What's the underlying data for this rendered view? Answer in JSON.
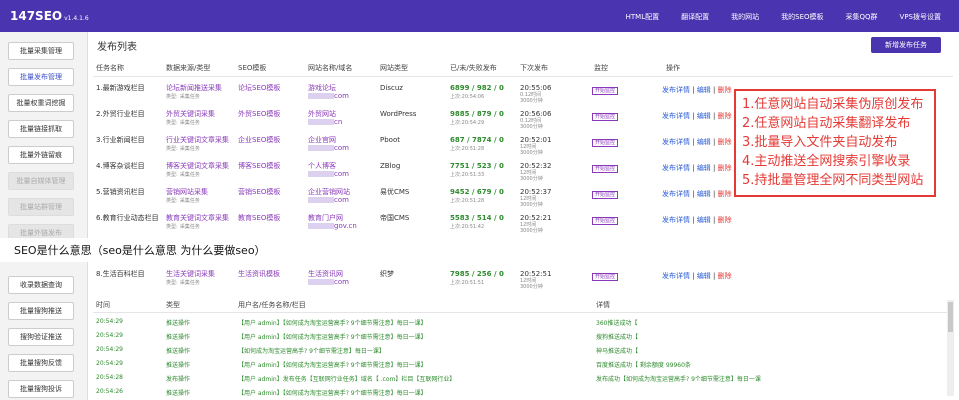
{
  "app": {
    "logo": "147SEO",
    "version": "v1.4.1.6"
  },
  "topnav": [
    "HTML配置",
    "翻译配置",
    "我的网站",
    "我的SEO模板",
    "采集QQ群",
    "VPS拨号设置"
  ],
  "sidebar": [
    {
      "label": "批量采集管理",
      "state": "normal"
    },
    {
      "label": "批量发布管理",
      "state": "active"
    },
    {
      "label": "批量权重词挖掘",
      "state": "normal"
    },
    {
      "label": "批量链接抓取",
      "state": "normal"
    },
    {
      "label": "批量外链留痕",
      "state": "normal"
    },
    {
      "label": "批量自媒体管理",
      "state": "disabled"
    },
    {
      "label": "批量站群管理",
      "state": "disabled"
    },
    {
      "label": "批量外链发布",
      "state": "disabled"
    },
    {
      "label": "收录数据查询",
      "state": "normal"
    },
    {
      "label": "批量搜狗推送",
      "state": "normal"
    },
    {
      "label": "搜狗验证推送",
      "state": "normal"
    },
    {
      "label": "批量搜狗反馈",
      "state": "normal"
    },
    {
      "label": "批量搜狗投诉",
      "state": "normal"
    }
  ],
  "page": {
    "title": "发布列表",
    "new_task": "新增发布任务"
  },
  "columns": [
    "任务名称",
    "数据来源/类型",
    "SEO模板",
    "网站名称/域名",
    "网站类型",
    "已/未/失败发布",
    "下次发布",
    "监控",
    "操作"
  ],
  "tasks": [
    {
      "name": "1.最新游戏栏目",
      "source": "论坛新闻推送采集",
      "type_label": "类型:",
      "type": "采集任务",
      "seo": "论坛SEO模板",
      "site": "游戏论坛",
      "domain": "com",
      "cms": "Discuz",
      "counts": "6899 / 982 / 0",
      "counts_l2": "上次:20:54:06",
      "next": "20:55:06",
      "next_l2": "0.12时间\n3000分钟",
      "monitor": "开始监控",
      "actions": [
        "发布详情",
        "编辑",
        "删除"
      ]
    },
    {
      "name": "2.外贸行业栏目",
      "source": "外贸关键词采集",
      "type_label": "类型:",
      "type": "采集任务",
      "seo": "外贸SEO模板",
      "site": "外贸网站",
      "domain": "cn",
      "cms": "WordPress",
      "counts": "9885 / 879 / 0",
      "counts_l2": "上次:20:54:29",
      "next": "20:56:06",
      "next_l2": "0.12时间\n3000分钟",
      "monitor": "开始监控",
      "actions": [
        "发布详情",
        "编辑",
        "删除"
      ]
    },
    {
      "name": "3.行业新闻栏目",
      "source": "行业关键词文章采集",
      "type_label": "类型:",
      "type": "采集任务",
      "seo": "企业SEO模板",
      "site": "企业官网",
      "domain": "com",
      "cms": "Pboot",
      "counts": "687 / 7874 / 0",
      "counts_l2": "上次:20:51:28",
      "next": "20:52:01",
      "next_l2": "12时间\n3000分钟",
      "monitor": "开始监控",
      "actions": [
        "发布详情",
        "编辑",
        "删除"
      ]
    },
    {
      "name": "4.博客杂谈栏目",
      "source": "博客关键词文章采集",
      "type_label": "类型:",
      "type": "采集任务",
      "seo": "博客SEO模板",
      "site": "个人博客",
      "domain": "com",
      "cms": "ZBlog",
      "counts": "7751 / 523 / 0",
      "counts_l2": "上次:20:51:33",
      "next": "20:52:32",
      "next_l2": "12时间\n3000分钟",
      "monitor": "开始监控",
      "actions": [
        "发布详情",
        "编辑",
        "删除"
      ]
    },
    {
      "name": "5.营销资讯栏目",
      "source": "营销网站采集",
      "type_label": "类型:",
      "type": "采集任务",
      "seo": "营销SEO模板",
      "site": "企业营销网站",
      "domain": "com",
      "cms": "易优CMS",
      "counts": "9452 / 679 / 0",
      "counts_l2": "上次:20:51:28",
      "next": "20:52:37",
      "next_l2": "12时间\n3000分钟",
      "monitor": "开始监控",
      "actions": [
        "发布详情",
        "编辑",
        "删除"
      ]
    },
    {
      "name": "6.教育行业动态栏目",
      "source": "教育关键词文章采集",
      "type_label": "类型:",
      "type": "采集任务",
      "seo": "教育SEO模板",
      "site": "教育门户网",
      "domain": "gov.cn",
      "cms": "帝国CMS",
      "counts": "5583 / 514 / 0",
      "counts_l2": "上次:20:51:42",
      "next": "20:52:21",
      "next_l2": "12时间\n3000分钟",
      "monitor": "开始监控",
      "actions": [
        "发布详情",
        "编辑",
        "删除"
      ]
    },
    {
      "name": "8.生活百科栏目",
      "source": "生活关键词采集",
      "type_label": "类型:",
      "type": "采集任务",
      "seo": "生活资讯模板",
      "site": "生活资讯网",
      "domain": "com",
      "cms": "织梦",
      "counts": "7985 / 256 / 0",
      "counts_l2": "上次:20:51:51",
      "next": "20:52:51",
      "next_l2": "12时间\n3000分钟",
      "monitor": "开始监控",
      "actions": [
        "发布详情",
        "编辑",
        "删除"
      ]
    }
  ],
  "callout": [
    "1.任意网站自动采集伪原创发布",
    "2.任意网站自动采集翻译发布",
    "3.批量导入文件夹自动发布",
    "4.主动推送全网搜索引擎收录",
    "5.持批量管理全网不同类型网站"
  ],
  "overlay_text": "SEO是什么意思（seo是什么意思 为什么要做seo）",
  "log": {
    "headers": [
      "时间",
      "类型",
      "用户名/任务名称/栏目",
      "详情"
    ],
    "rows": [
      {
        "time": "20:54:29",
        "type": "推送操作",
        "task": "【用户 admin】【如何成为淘宝运营高手? 9个细节需注意】每日一课】",
        "detail": "360推送成功【"
      },
      {
        "time": "20:54:29",
        "type": "推送操作",
        "task": "【用户 admin】【如何成为淘宝运营高手? 9个细节需注意】每日一课】",
        "detail": "搜狗推送成功【"
      },
      {
        "time": "20:54:29",
        "type": "推送操作",
        "task": "【如何成为淘宝运营高手? 9个细节需注意】每日一课】",
        "detail": "神马推送成功【"
      },
      {
        "time": "20:54:29",
        "type": "推送操作",
        "task": "【用户 admin】【如何成为淘宝运营高手? 9个细节需注意】每日一课】",
        "detail": "百度推送成功【            剩余额度 99960条"
      },
      {
        "time": "20:54:28",
        "type": "发布操作",
        "task": "【用户 admin】发布任务【互联网行业任务】域名【             .com】栏目【互联网行业】",
        "detail": "发布成功【如何成为淘宝运营高手? 9个细节需注意】每日一课"
      },
      {
        "time": "20:54:26",
        "type": "推送操作",
        "task": "【用户 admin】【如何成为淘宝运营高手? 9个细节需注意】每日一课】",
        "detail": ""
      }
    ]
  },
  "colors": {
    "primary": "#4a34b0",
    "callout_red": "#e53935",
    "link_blue": "#2a5bd7",
    "count_green": "#2e8b2e"
  }
}
